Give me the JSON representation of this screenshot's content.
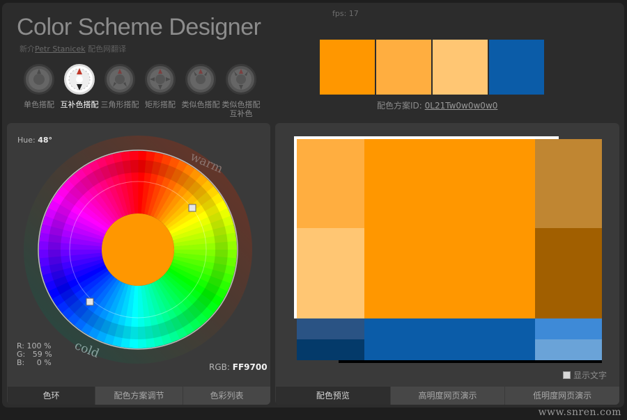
{
  "header": {
    "fps": "fps: 17",
    "title": "Color Scheme Designer",
    "credit_prefix": "新介",
    "credit_author": "Petr Stanicek",
    "credit_suffix": "配色网翻译"
  },
  "schemes": [
    {
      "label": "单色搭配",
      "active": false
    },
    {
      "label": "互补色搭配",
      "active": true
    },
    {
      "label": "三角形搭配",
      "active": false
    },
    {
      "label": "矩形搭配",
      "active": false
    },
    {
      "label": "类似色搭配",
      "active": false
    },
    {
      "label": "类似色搭配互补色",
      "active": false
    }
  ],
  "swatches": [
    "#FF9700",
    "#FFAE40",
    "#FFC673",
    "#0B5CA8"
  ],
  "scheme_id": {
    "label": "配色方案ID:",
    "value": "0L21Tw0w0w0w0"
  },
  "wheel": {
    "hue_label": "Hue:",
    "hue_value": "48°",
    "warm_label": "warm",
    "cold_label": "cold",
    "center_color": "#FF9700",
    "rgb_lines": "R: 100 %\nG:   59 %\nB:     0 %",
    "rgb_label": "RGB:",
    "rgb_value": "FF9700"
  },
  "left_tabs": [
    {
      "label": "色环",
      "active": true
    },
    {
      "label": "配色方案调节",
      "active": false
    },
    {
      "label": "色彩列表",
      "active": false
    }
  ],
  "preview": {
    "colors": {
      "primary": "#FF9700",
      "light1": "#FFAE40",
      "light2": "#FFC673",
      "dark1": "#C08632",
      "dark2": "#A15F00",
      "comp": "#0B5CA8",
      "comp_dark1": "#2A5384",
      "comp_dark2": "#043A6A",
      "comp_light1": "#3E8AD7",
      "comp_light2": "#6AA3D8"
    },
    "show_text_label": "显示文字"
  },
  "right_tabs": [
    {
      "label": "配色预览",
      "active": true
    },
    {
      "label": "高明度网页演示",
      "active": false
    },
    {
      "label": "低明度网页演示",
      "active": false
    }
  ],
  "watermark": "www.snren.com"
}
